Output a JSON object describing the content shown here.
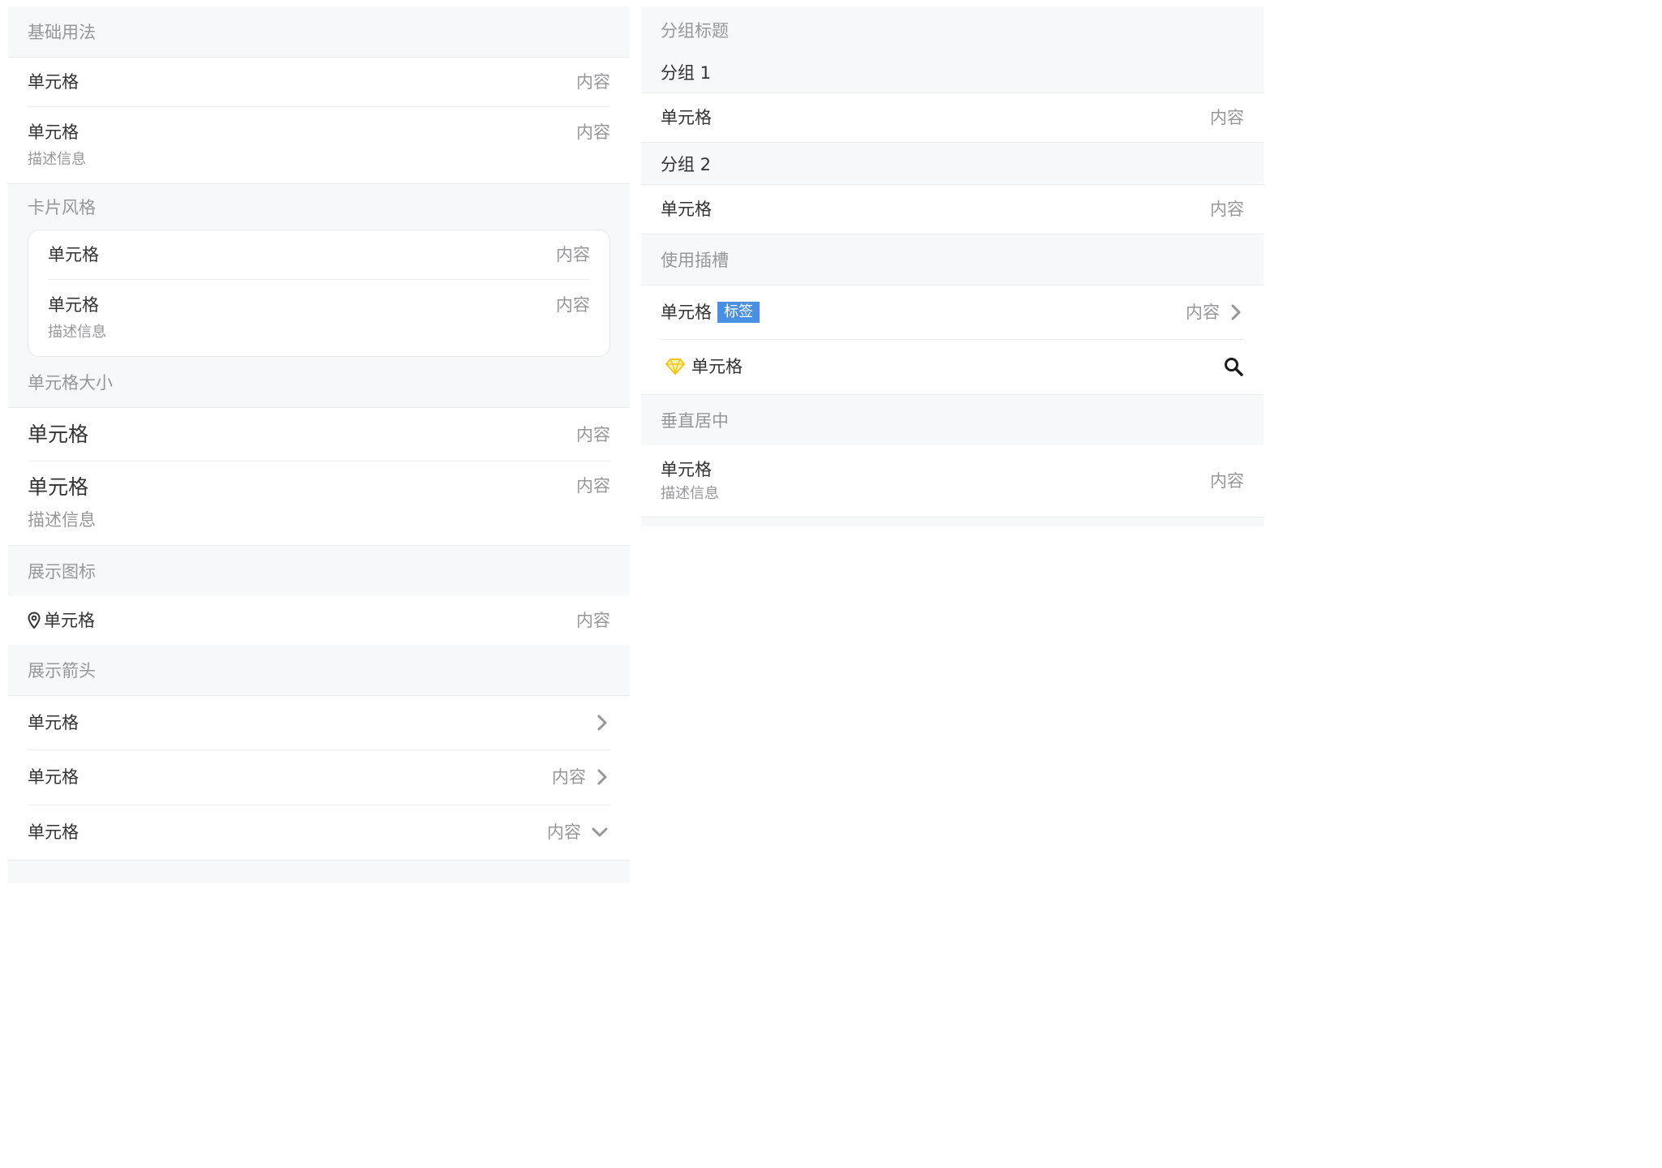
{
  "basic": {
    "title": "基础用法",
    "cells": [
      {
        "title": "单元格",
        "value": "内容"
      },
      {
        "title": "单元格",
        "value": "内容",
        "label": "描述信息"
      }
    ]
  },
  "card": {
    "title": "卡片风格",
    "cells": [
      {
        "title": "单元格",
        "value": "内容"
      },
      {
        "title": "单元格",
        "value": "内容",
        "label": "描述信息"
      }
    ]
  },
  "size": {
    "title": "单元格大小",
    "cells": [
      {
        "title": "单元格",
        "value": "内容"
      },
      {
        "title": "单元格",
        "value": "内容",
        "label": "描述信息"
      }
    ]
  },
  "icon": {
    "title": "展示图标",
    "cell": {
      "title": "单元格",
      "value": "内容",
      "icon": "location-icon"
    }
  },
  "arrow": {
    "title": "展示箭头",
    "cells": [
      {
        "title": "单元格",
        "arrow": "chevron-right-icon"
      },
      {
        "title": "单元格",
        "value": "内容",
        "arrow": "chevron-right-icon"
      },
      {
        "title": "单元格",
        "value": "内容",
        "arrow": "chevron-down-icon"
      }
    ]
  },
  "group": {
    "title": "分组标题",
    "groups": [
      {
        "title": "分组 1",
        "cell": {
          "title": "单元格",
          "value": "内容"
        }
      },
      {
        "title": "分组 2",
        "cell": {
          "title": "单元格",
          "value": "内容"
        }
      }
    ]
  },
  "slots": {
    "title": "使用插槽",
    "cells": [
      {
        "title": "单元格",
        "tag": "标签",
        "value": "内容",
        "arrow": "chevron-right-icon"
      },
      {
        "title": "单元格",
        "icon": "diamond-icon",
        "right_icon": "search-icon"
      }
    ]
  },
  "center": {
    "title": "垂直居中",
    "cell": {
      "title": "单元格",
      "label": "描述信息",
      "value": "内容"
    }
  },
  "colors": {
    "background": "#f7f8fa",
    "text": "#323233",
    "muted": "#969799",
    "border": "#ebedf0",
    "tag": "#4a90e2",
    "diamond": "#f5c518"
  }
}
